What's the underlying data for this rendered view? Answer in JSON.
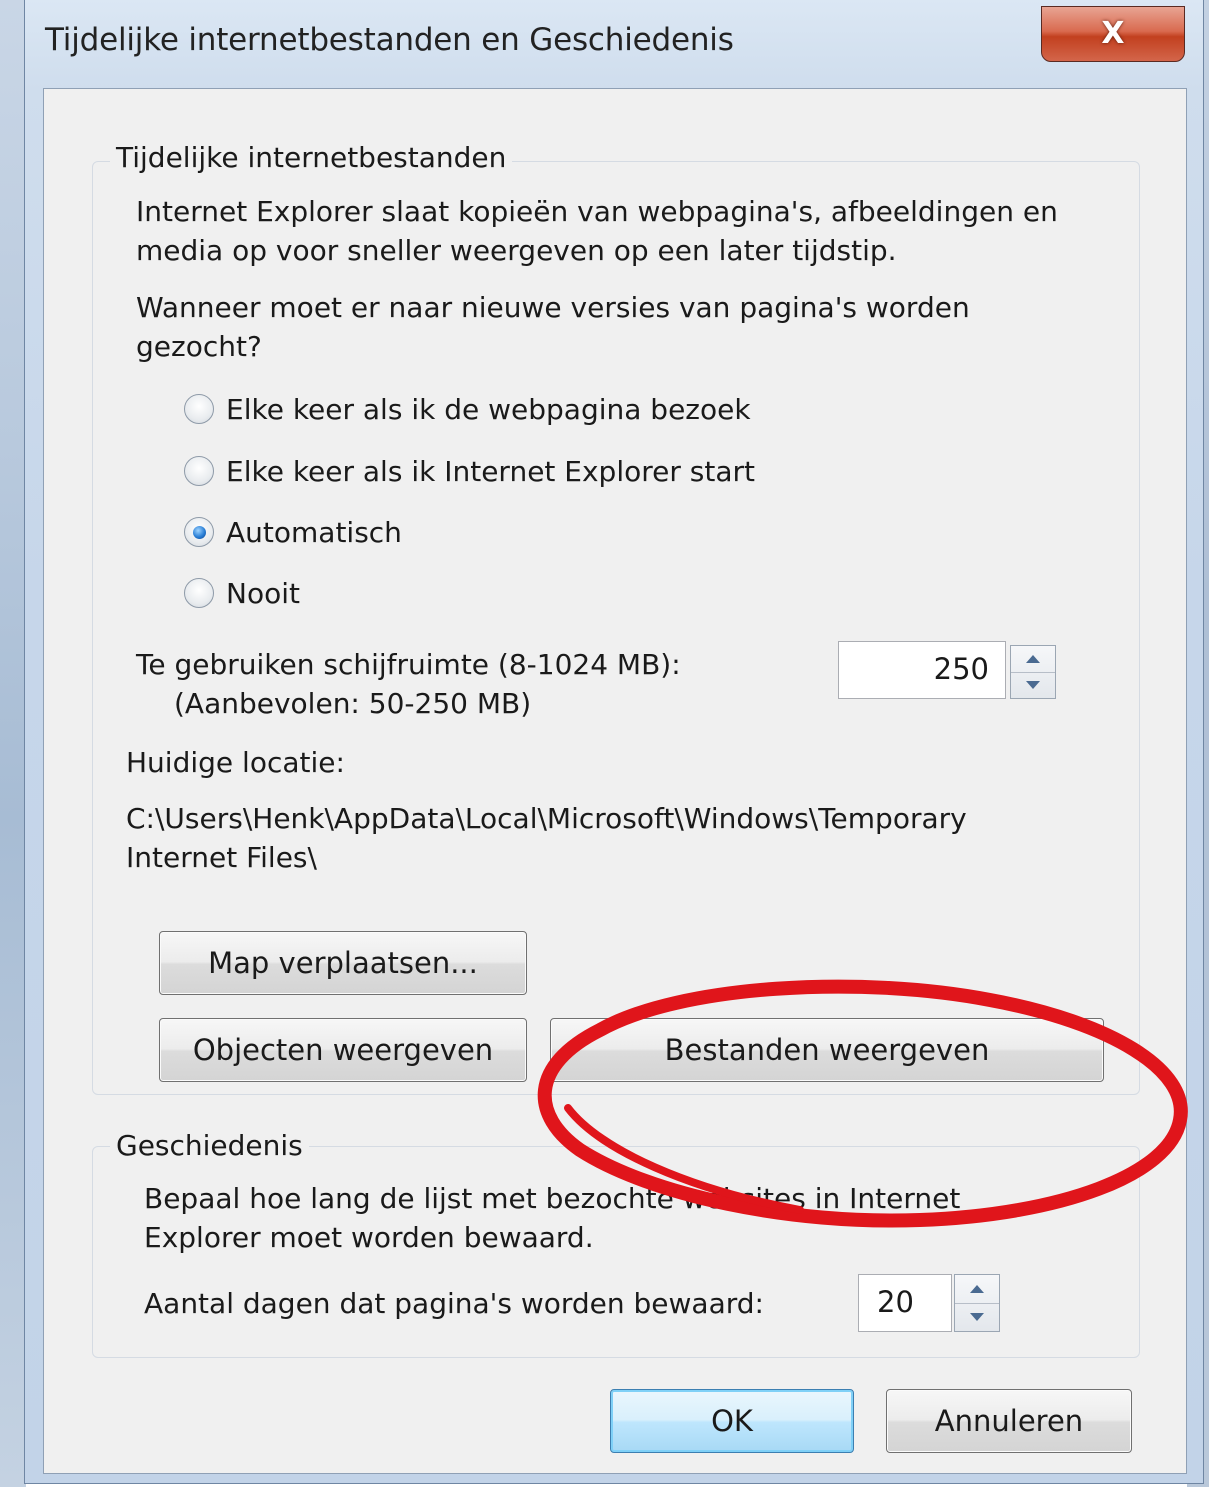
{
  "window": {
    "title": "Tijdelijke internetbestanden en Geschiedenis",
    "close_label": "X"
  },
  "temp_files": {
    "caption": "Tijdelijke internetbestanden",
    "description_line1": "Internet Explorer slaat kopieën van webpagina's, afbeeldingen en",
    "description_line2": "media op voor sneller weergeven op een later tijdstip.",
    "question_line1": "Wanneer moet er naar nieuwe versies van pagina's worden",
    "question_line2": "gezocht?",
    "options": [
      {
        "label": "Elke keer als ik de webpagina bezoek",
        "checked": false
      },
      {
        "label": "Elke keer als ik Internet Explorer start",
        "checked": false
      },
      {
        "label": "Automatisch",
        "checked": true
      },
      {
        "label": "Nooit",
        "checked": false
      }
    ],
    "disk_space_label": "Te gebruiken schijfruimte (8-1024 MB):",
    "disk_space_recommended": "(Aanbevolen: 50-250 MB)",
    "disk_space_value": "250",
    "location_label": "Huidige locatie:",
    "location_path_line1": "C:\\Users\\Henk\\AppData\\Local\\Microsoft\\Windows\\Temporary",
    "location_path_line2": "Internet Files\\",
    "move_folder_button": "Map verplaatsen...",
    "view_objects_button": "Objecten weergeven",
    "view_files_button": "Bestanden weergeven"
  },
  "history": {
    "caption": "Geschiedenis",
    "description_line1": "Bepaal hoe lang de lijst met bezochte websites in Internet",
    "description_line2": "Explorer moet worden bewaard.",
    "days_label": "Aantal dagen dat pagina's worden bewaard:",
    "days_value": "20"
  },
  "footer": {
    "ok_button": "OK",
    "cancel_button": "Annuleren"
  },
  "colors": {
    "annotation": "#e0151b",
    "radio_selected": "#2a7fd6",
    "default_button_border": "#3c7fb1"
  },
  "icons": {
    "close": "close-icon",
    "spin_up": "spin-up-icon",
    "spin_down": "spin-down-icon"
  }
}
